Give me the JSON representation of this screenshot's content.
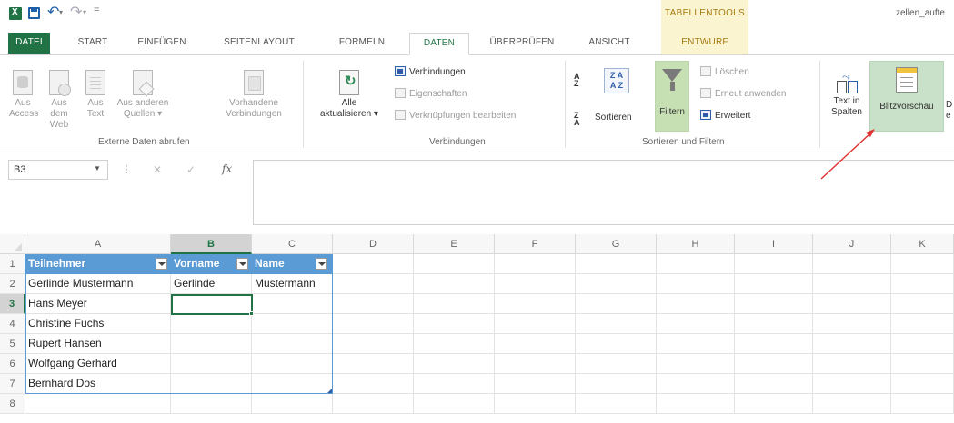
{
  "window": {
    "contextual_group_title": "TABELLENTOOLS",
    "filename": "zellen_aufte"
  },
  "tabs": [
    {
      "label": "DATEI"
    },
    {
      "label": "START"
    },
    {
      "label": "EINFÜGEN"
    },
    {
      "label": "SEITENLAYOUT"
    },
    {
      "label": "FORMELN"
    },
    {
      "label": "DATEN"
    },
    {
      "label": "ÜBERPRÜFEN"
    },
    {
      "label": "ANSICHT"
    },
    {
      "label": "ENTWURF"
    }
  ],
  "ribbon": {
    "external": {
      "access": "Aus Access",
      "access_l1": "Aus",
      "access_l2": "Access",
      "web_l1": "Aus dem",
      "web_l2": "Web",
      "text_l1": "Aus",
      "text_l2": "Text",
      "other_l1": "Aus anderen",
      "other_l2": "Quellen ▾",
      "existing_l1": "Vorhandene",
      "existing_l2": "Verbindungen",
      "group_label": "Externe Daten abrufen"
    },
    "connections": {
      "refresh_l1": "Alle",
      "refresh_l2": "aktualisieren ▾",
      "connections": "Verbindungen",
      "properties": "Eigenschaften",
      "edit_links": "Verknüpfungen bearbeiten",
      "group_label": "Verbindungen"
    },
    "sort_filter": {
      "sort": "Sortieren",
      "filter": "Filtern",
      "clear": "Löschen",
      "reapply": "Erneut anwenden",
      "advanced": "Erweitert",
      "group_label": "Sortieren und Filtern",
      "az_top": "A",
      "az_bottom": "Z",
      "za_top": "Z",
      "za_bottom": "A",
      "box_l1": "Z A",
      "box_l2": "A Z"
    },
    "data_tools": {
      "text_to_columns_l1": "Text in",
      "text_to_columns_l2": "Spalten",
      "flash_fill": "Blitzvorschau",
      "cut_l1": "D",
      "cut_l2": "e"
    }
  },
  "formula_bar": {
    "name_box": "B3",
    "separator": "⋮",
    "cancel": "✕",
    "enter": "✓",
    "fx": "fx",
    "value": ""
  },
  "sheet": {
    "columns": [
      "A",
      "B",
      "C",
      "D",
      "E",
      "F",
      "G",
      "H",
      "I",
      "J",
      "K"
    ],
    "rows": [
      "1",
      "2",
      "3",
      "4",
      "5",
      "6",
      "7",
      "8"
    ],
    "selected_column": "B",
    "selected_row": "3",
    "table_headers": [
      "Teilnehmer",
      "Vorname",
      "Name"
    ],
    "table_rows": [
      [
        "Gerlinde Mustermann",
        "Gerlinde",
        "Mustermann"
      ],
      [
        "Hans Meyer",
        "",
        ""
      ],
      [
        "Christine Fuchs",
        "",
        ""
      ],
      [
        "Rupert Hansen",
        "",
        ""
      ],
      [
        "Wolfgang Gerhard",
        "",
        ""
      ],
      [
        "Bernhard Dos",
        "",
        ""
      ]
    ]
  },
  "colors": {
    "excel_green": "#217346",
    "table_header": "#5b9bd5",
    "filter_highlight": "#c6e0b4",
    "contextual": "#a57b13",
    "annotation_arrow": "#e03030"
  },
  "icons": {
    "excel": "excel-logo-icon",
    "save": "save-icon",
    "undo": "undo-icon",
    "redo": "redo-icon",
    "filter": "funnel-icon",
    "flash_fill": "flash-fill-icon",
    "text_to_columns": "text-to-columns-icon"
  }
}
